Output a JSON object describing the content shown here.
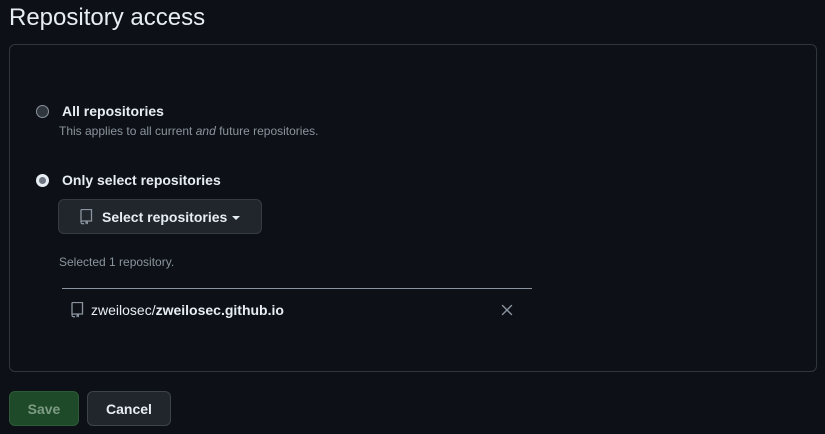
{
  "page": {
    "title": "Repository access"
  },
  "access": {
    "all": {
      "label": "All repositories",
      "note_prefix": "This applies to all current ",
      "note_em": "and",
      "note_suffix": " future repositories.",
      "checked": false
    },
    "select": {
      "label": "Only select repositories",
      "checked": true,
      "button_label": "Select repositories",
      "button_icon": "repo-icon",
      "selected_count_text": "Selected 1 repository."
    }
  },
  "selected_repos": [
    {
      "owner": "zweilosec/",
      "name": "zweilosec.github.io",
      "icon": "repo-icon",
      "remove_icon": "close-icon"
    }
  ],
  "actions": {
    "save_label": "Save",
    "cancel_label": "Cancel"
  },
  "colors": {
    "background": "#0d1117",
    "border": "#30363d",
    "save_button_bg": "#1f4a29",
    "muted_text": "#8b949e"
  }
}
